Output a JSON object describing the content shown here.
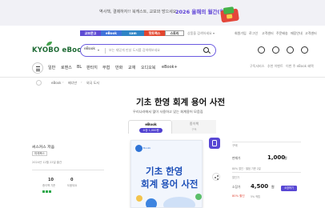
{
  "promo": {
    "text": "역사책, 결제하자!! 북캐스트, 교보와 방으세요",
    "accent": "2026 올해의 월간(월)!"
  },
  "service_tabs": [
    "교보문고",
    "eBook",
    "sam",
    "핫트랙스",
    "스토리"
  ],
  "service_category": "상품을 검색하세요 ▾",
  "util_links": [
    "회원가입",
    "로그인",
    "고객센터",
    "주문배송",
    "매장안내",
    "고객센터"
  ],
  "logo": {
    "text": "KYOBO eBook"
  },
  "search": {
    "selector": "eBook",
    "placeholder": "보는 재밌게 만날 도서를 검색해보세요"
  },
  "header_icons": [
    "cart-icon",
    "user-icon",
    "bell-icon",
    "library-icon"
  ],
  "header_links": [
    "구독서비스",
    "추천 이벤트",
    "이번 주 eBook 혜택",
    "전 도서"
  ],
  "nav": {
    "items": [
      "일반",
      "로맨스",
      "BL",
      "판타지",
      "무협",
      "만화",
      "교재",
      "오디오북",
      "eBook+"
    ]
  },
  "breadcrumb": [
    "eBook",
    "배너만",
    "외국 도서"
  ],
  "product": {
    "title": "기초 한영 회계 용어 사전",
    "subtitle": "우리나라에서 많이 사용하고 있는 회계용어 모음집",
    "formats": [
      {
        "name": "eBook",
        "pill": "소장 1,000원"
      },
      {
        "name": "종이책",
        "sub": "구독"
      }
    ],
    "cover": {
      "publisher": "Bookk",
      "title_line1": "기초 한영",
      "title_line2": "회계 용어 사전"
    }
  },
  "left_panel": {
    "author": "씨스커스 저음",
    "publisher_tag": "미래북스",
    "date": "2024년 12월 22일 출간",
    "stats": [
      {
        "value": "10",
        "label": "종이책 기준"
      },
      {
        "value": "0",
        "label": "도움되요"
      }
    ]
  },
  "right_panel": {
    "column_labels": [
      "구매",
      "대여"
    ],
    "price_label_1": "판매가",
    "price_1": "1,000",
    "unit": "원",
    "discount_note": "80% 할인 · 별점 기준 2일",
    "sale_line_label": "할인가",
    "price_2_label": "소장가",
    "price_2": "4,500",
    "discount_rate": "80% 할인",
    "point_note": "5% 적립",
    "cart_button": "소장하기"
  }
}
